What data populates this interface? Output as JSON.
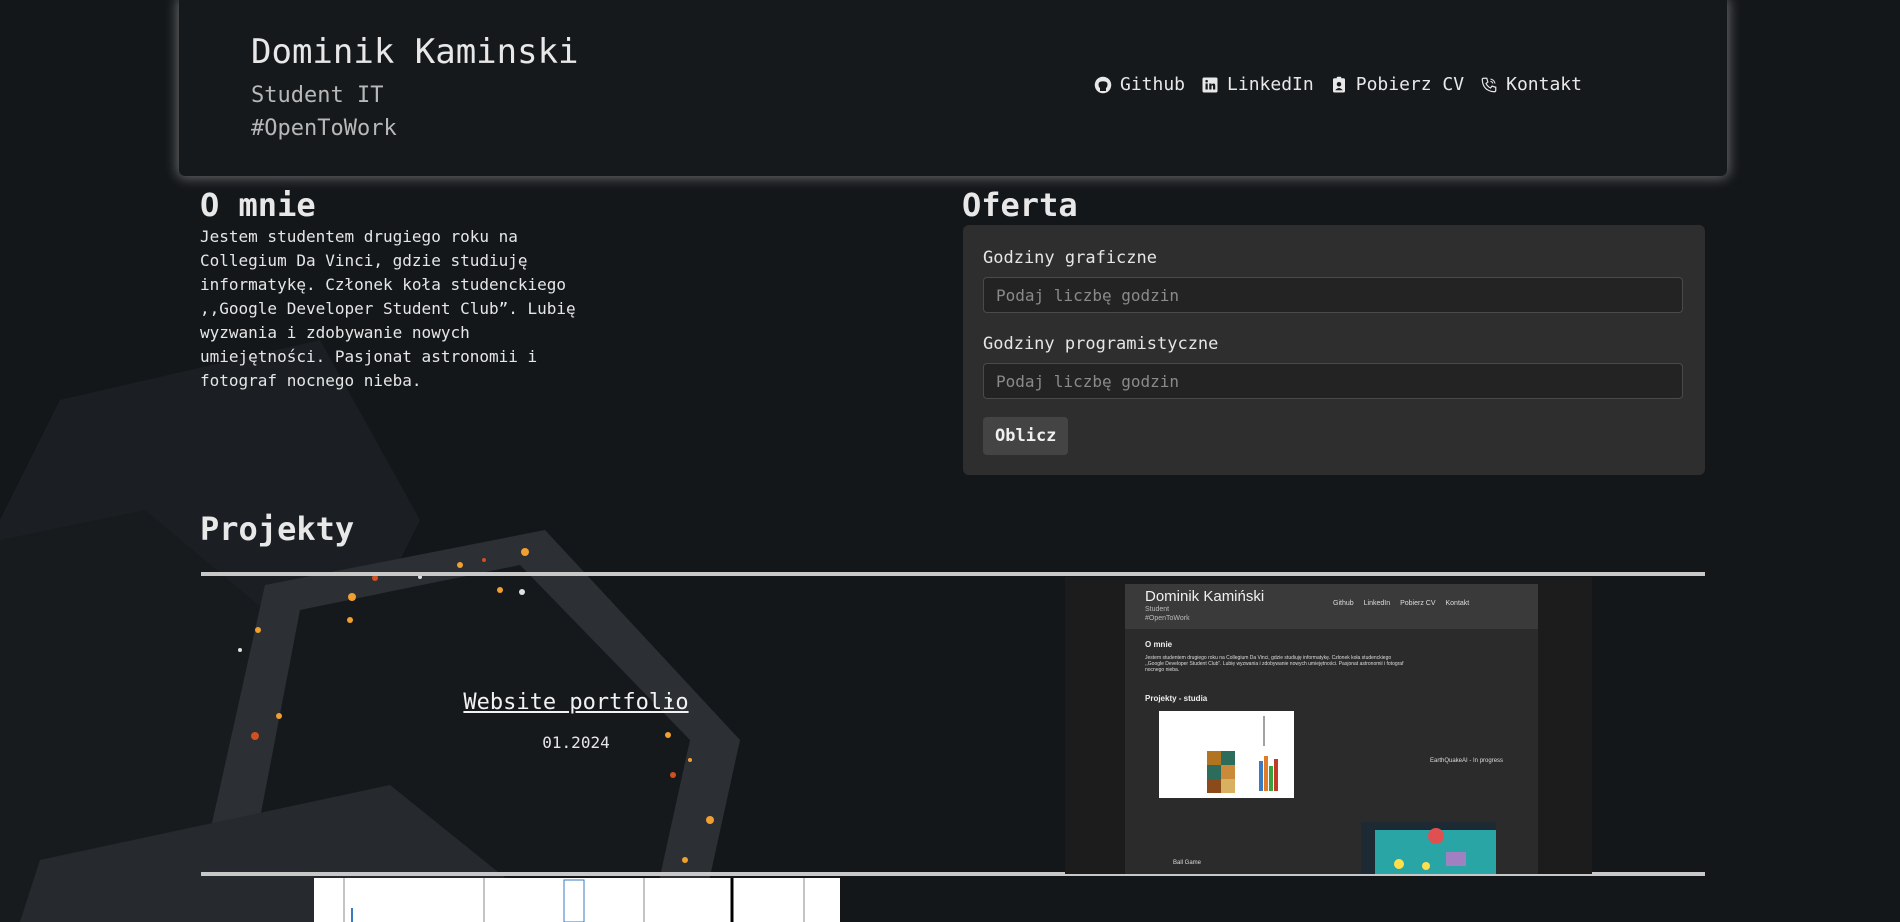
{
  "header": {
    "name": "Dominik Kaminski",
    "subtitle": "Student IT",
    "hashtag": "#OpenToWork",
    "nav": [
      {
        "label": "Github",
        "icon": "github-icon"
      },
      {
        "label": "LinkedIn",
        "icon": "linkedin-icon"
      },
      {
        "label": "Pobierz CV",
        "icon": "id-badge-icon"
      },
      {
        "label": "Kontakt",
        "icon": "phone-icon"
      }
    ]
  },
  "about": {
    "title": "O mnie",
    "text": "Jestem studentem drugiego roku na Collegium Da Vinci, gdzie studiuję informatykę. Członek koła studenckiego ,,Google Developer Student Club”. Lubię wyzwania i zdobywanie nowych umiejętności. Pasjonat astronomii i fotograf nocnego nieba."
  },
  "offer": {
    "title": "Oferta",
    "graphic_label": "Godziny graficzne",
    "graphic_placeholder": "Podaj liczbę godzin",
    "programming_label": "Godziny programistyczne",
    "programming_placeholder": "Podaj liczbę godzin",
    "button": "Oblicz"
  },
  "projects": {
    "title": "Projekty",
    "items": [
      {
        "name": "Website portfolio",
        "date": "01.2024"
      }
    ],
    "thumbnail": {
      "name": "Dominik Kamiński",
      "subtitle": "Student",
      "hashtag": "#OpenToWork",
      "nav": [
        "Github",
        "LinkedIn",
        "Pobierz CV",
        "Kontakt"
      ],
      "about_title": "O mnie",
      "about_text": "Jestem studentem drugiego roku na Collegium Da Vinci, gdzie studiuję informatykę. Członek koła studenckiego ,,Google Developer Student Club”. Lubię wyzwania i zdobywanie nowych umiejętności. Pasjonat astronomii i fotograf nocnego nieba.",
      "projects_title": "Projekty - studia",
      "earthquake": "EarthQuakeAI - In progress",
      "ballgame": "Ball Game"
    }
  },
  "colors": {
    "background": "#14171a",
    "card": "#2e2e2e",
    "divider": "#c8c8c8",
    "accent_orange": "#f0a030"
  }
}
